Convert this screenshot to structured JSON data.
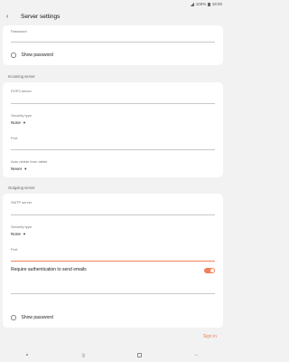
{
  "status_bar": {
    "battery": "100%",
    "time": "18:00"
  },
  "header": {
    "title": "Server settings"
  },
  "account": {
    "password_label": "Password",
    "show_password_label": "Show password"
  },
  "incoming": {
    "section_title": "Incoming server",
    "server_label": "POP3 server",
    "security_label": "Security type",
    "security_value": "None",
    "port_label": "Port",
    "auto_delete_label": "Auto delete from tablet",
    "auto_delete_value": "Never"
  },
  "outgoing": {
    "section_title": "Outgoing server",
    "server_label": "SMTP server",
    "security_label": "Security type",
    "security_value": "None",
    "port_label": "Port",
    "require_auth_label": "Require authentication to send emails",
    "require_auth_on": true,
    "show_password_label": "Show password"
  },
  "footer": {
    "signin_label": "Sign in"
  },
  "icons": {
    "back": "back-arrow-icon",
    "caret": "dropdown-caret-icon",
    "nav": [
      "dot-icon",
      "recent-apps-icon",
      "home-icon",
      "back-icon"
    ]
  },
  "colors": {
    "accent": "#f47f5a",
    "background": "#f2f2f2",
    "card": "#ffffff"
  }
}
